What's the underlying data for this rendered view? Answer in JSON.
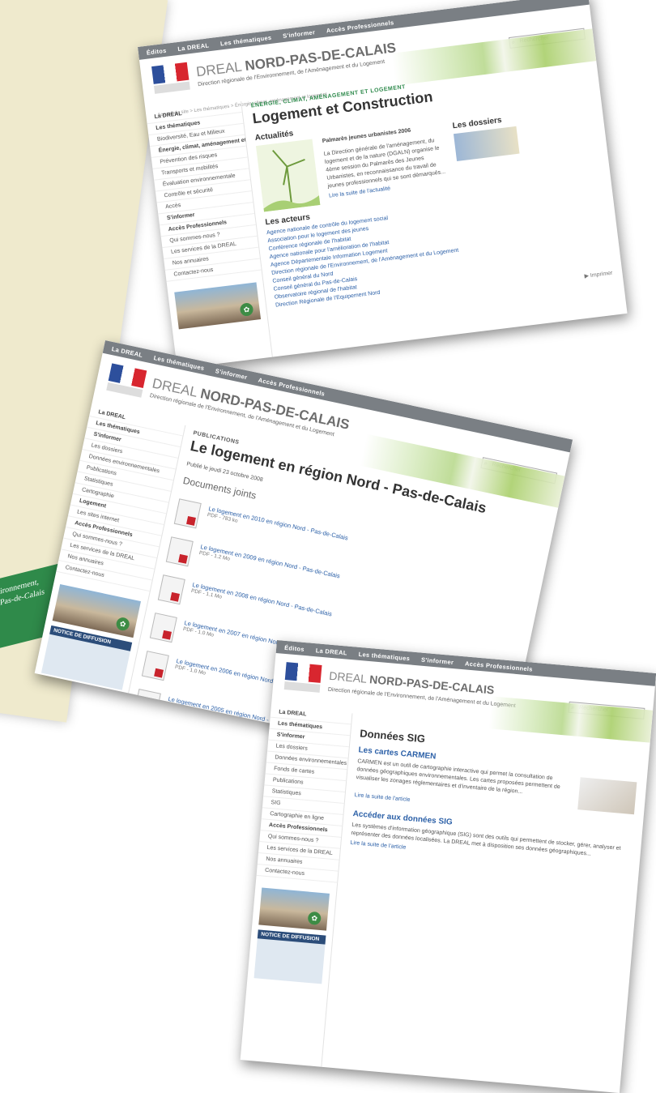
{
  "green_strip": {
    "line1": "ironnement,",
    "line2": "Pas-de-Calais"
  },
  "shot1": {
    "topbar": [
      "Éditos",
      "La DREAL",
      "Les thématiques",
      "S'informer",
      "Accès Professionnels"
    ],
    "search_placeholder": "Rechercher",
    "brand_prefix": "DREAL ",
    "brand_bold": "NORD-PAS-DE-CALAIS",
    "subbrand": "Direction régionale de l'Environnement, de l'Aménagement et du Logement",
    "breadcrumb": "Accueil du site > Les thématiques > Énergie, climat, aménagement et logement",
    "sidebar": [
      "La DREAL",
      "Les thématiques",
      "Biodiversité, Eau et Milieux",
      "Énergie, climat, aménagement et logement",
      "Prévention des risques",
      "Transports et mobilités",
      "Évaluation environnementale",
      "Contrôle et sécurité",
      "Accès",
      "S'informer",
      "Accès Professionnels",
      "Qui sommes-nous ?",
      "Les services de la DREAL",
      "Nos annuaires",
      "Contactez-nous"
    ],
    "kicker": "ÉNERGIE, CLIMAT, AMÉNAGEMENT ET LOGEMENT",
    "title": "Logement et Construction",
    "news_heading": "Actualités",
    "news_title": "Palmarès jeunes urbanistes 2006",
    "news_text": "La Direction générale de l'aménagement, du logement et de la nature (DGALN) organise le 4ème session du Palmarès des Jeunes Urbanistes, en reconnaissance du travail de jeunes professionnels qui se sont démarqués...",
    "news_link": "Lire la suite de l'actualité",
    "dossiers_heading": "Les dossiers",
    "acteurs_heading": "Les acteurs",
    "acteurs": [
      "Agence nationale de contrôle du logement social",
      "Association pour le logement des jeunes",
      "Conférence régionale de l'habitat",
      "Agence nationale pour l'amélioration de l'habitat",
      "Agence Départementale Information Logement",
      "Direction régionale de l'Environnement, de l'Aménagement et du Logement",
      "Conseil général du Nord",
      "Conseil général du Pas-de-Calais",
      "Observatoire régional de l'habitat",
      "Direction Régionale de l'Équipement Nord"
    ],
    "page_footer": "▶ Imprimer"
  },
  "shot2": {
    "topbar": [
      "La DREAL",
      "Les thématiques",
      "S'informer",
      "Accès Professionnels"
    ],
    "brand_prefix": "DREAL ",
    "brand_bold": "NORD-PAS-DE-CALAIS",
    "subbrand": "Direction régionale de l'Environnement, de l'Aménagement et du Logement",
    "search_placeholder": "Rechercher",
    "sidebar": [
      "La DREAL",
      "Les thématiques",
      "S'informer",
      "Les dossiers",
      "Données environnementales",
      "Publications",
      "Statistiques",
      "Cartographie",
      "Logement",
      "Les sites internet",
      "Accès Professionnels",
      "Qui sommes-nous ?",
      "Les services de la DREAL",
      "Nos annuaires",
      "Contactez-nous"
    ],
    "kicker": "PUBLICATIONS",
    "title": "Le logement en région Nord - Pas-de-Calais",
    "meta": "Publié le jeudi 23 octobre 2008",
    "docs_heading": "Documents joints",
    "docs": [
      {
        "title": "Le logement en 2010 en région Nord - Pas-de-Calais",
        "meta": "PDF - 783 ko"
      },
      {
        "title": "Le logement en 2009 en région Nord - Pas-de-Calais",
        "meta": "PDF - 1.2 Mo"
      },
      {
        "title": "Le logement en 2008 en région Nord - Pas-de-Calais",
        "meta": "PDF - 1.1 Mo"
      },
      {
        "title": "Le logement en 2007 en région Nord - Pas-de-Calais",
        "meta": "PDF - 1.0 Mo"
      },
      {
        "title": "Le logement en 2006 en région Nord - Pas-de-Calais",
        "meta": "PDF - 1.0 Mo"
      },
      {
        "title": "Le logement en 2005 en région Nord - Pas-de-Calais",
        "meta": "PDF - 950 ko"
      }
    ],
    "notice_label": "NOTICE DE DIFFUSION"
  },
  "shot3": {
    "topbar": [
      "Éditos",
      "La DREAL",
      "Les thématiques",
      "S'informer",
      "Accès Professionnels"
    ],
    "brand_prefix": "DREAL ",
    "brand_bold": "NORD-PAS-DE-CALAIS",
    "subbrand": "Direction régionale de l'Environnement, de l'Aménagement et du Logement",
    "search_placeholder": "Rechercher",
    "sidebar": [
      "La DREAL",
      "Les thématiques",
      "S'informer",
      "Les dossiers",
      "Données environnementales",
      "Fonds de cartes",
      "Publications",
      "Statistiques",
      "SIG",
      "Cartographie en ligne",
      "Accès Professionnels",
      "Qui sommes-nous ?",
      "Les services de la DREAL",
      "Nos annuaires",
      "Contactez-nous"
    ],
    "title": "Données SIG",
    "section1_heading": "Les cartes CARMEN",
    "section1_text": "CARMEN est un outil de cartographie interactive qui permet la consultation de données géographiques environnementales. Les cartes proposées permettent de visualiser les zonages réglementaires et d'inventaire de la région...",
    "section1_link": "Lire la suite de l'article",
    "section2_heading": "Accéder aux données SIG",
    "section2_text": "Les systèmes d'information géographique (SIG) sont des outils qui permettent de stocker, gérer, analyser et représenter des données localisées. La DREAL met à disposition ses données géographiques...",
    "section2_link": "Lire la suite de l'article",
    "notice_label": "NOTICE DE DIFFUSION"
  }
}
